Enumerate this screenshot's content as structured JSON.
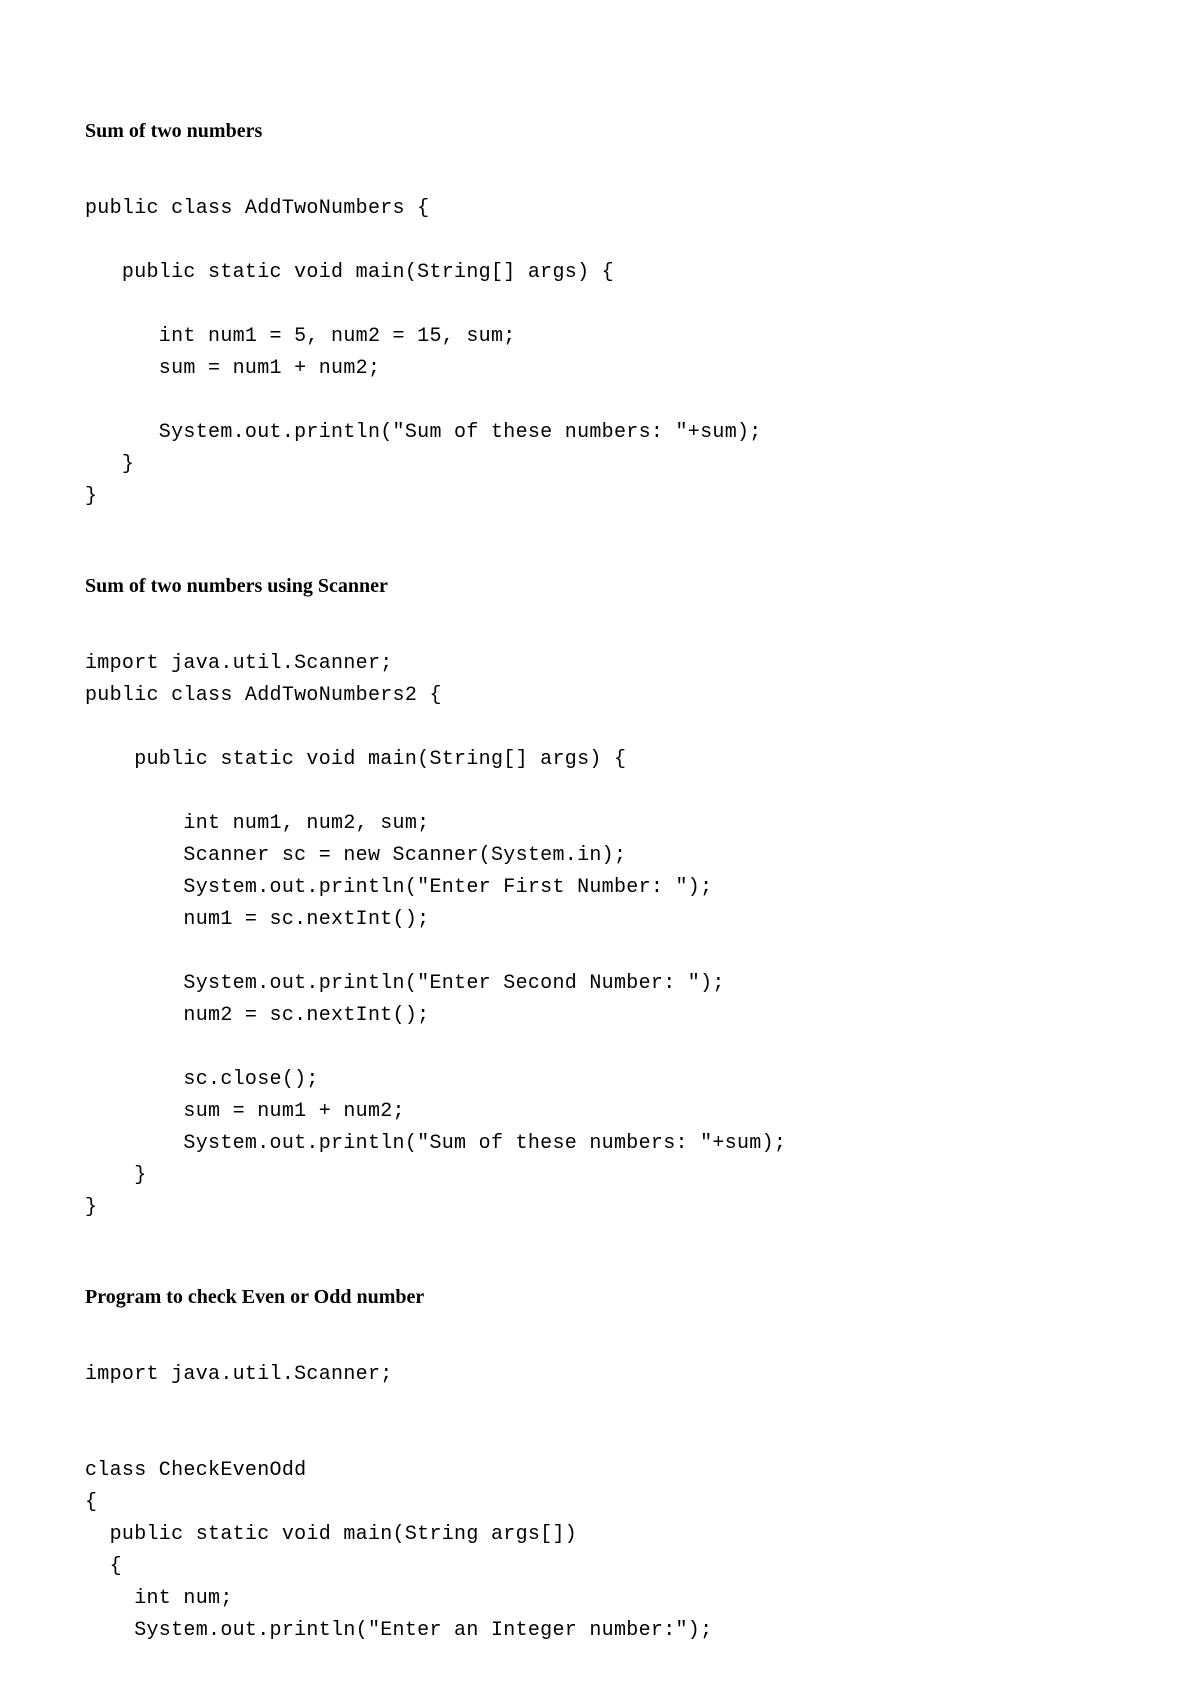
{
  "sections": [
    {
      "heading": "Sum of two numbers",
      "code": "public class AddTwoNumbers {\n\n   public static void main(String[] args) {\n\n      int num1 = 5, num2 = 15, sum;\n      sum = num1 + num2;\n\n      System.out.println(\"Sum of these numbers: \"+sum);\n   }\n}"
    },
    {
      "heading": "Sum of two numbers using Scanner",
      "code": "import java.util.Scanner;\npublic class AddTwoNumbers2 {\n\n    public static void main(String[] args) {\n\n        int num1, num2, sum;\n        Scanner sc = new Scanner(System.in);\n        System.out.println(\"Enter First Number: \");\n        num1 = sc.nextInt();\n\n        System.out.println(\"Enter Second Number: \");\n        num2 = sc.nextInt();\n\n        sc.close();\n        sum = num1 + num2;\n        System.out.println(\"Sum of these numbers: \"+sum);\n    }\n}"
    },
    {
      "heading": "Program to check Even or Odd number",
      "code": "import java.util.Scanner;\n\n\nclass CheckEvenOdd\n{\n  public static void main(String args[])\n  {\n    int num;\n    System.out.println(\"Enter an Integer number:\");"
    }
  ]
}
